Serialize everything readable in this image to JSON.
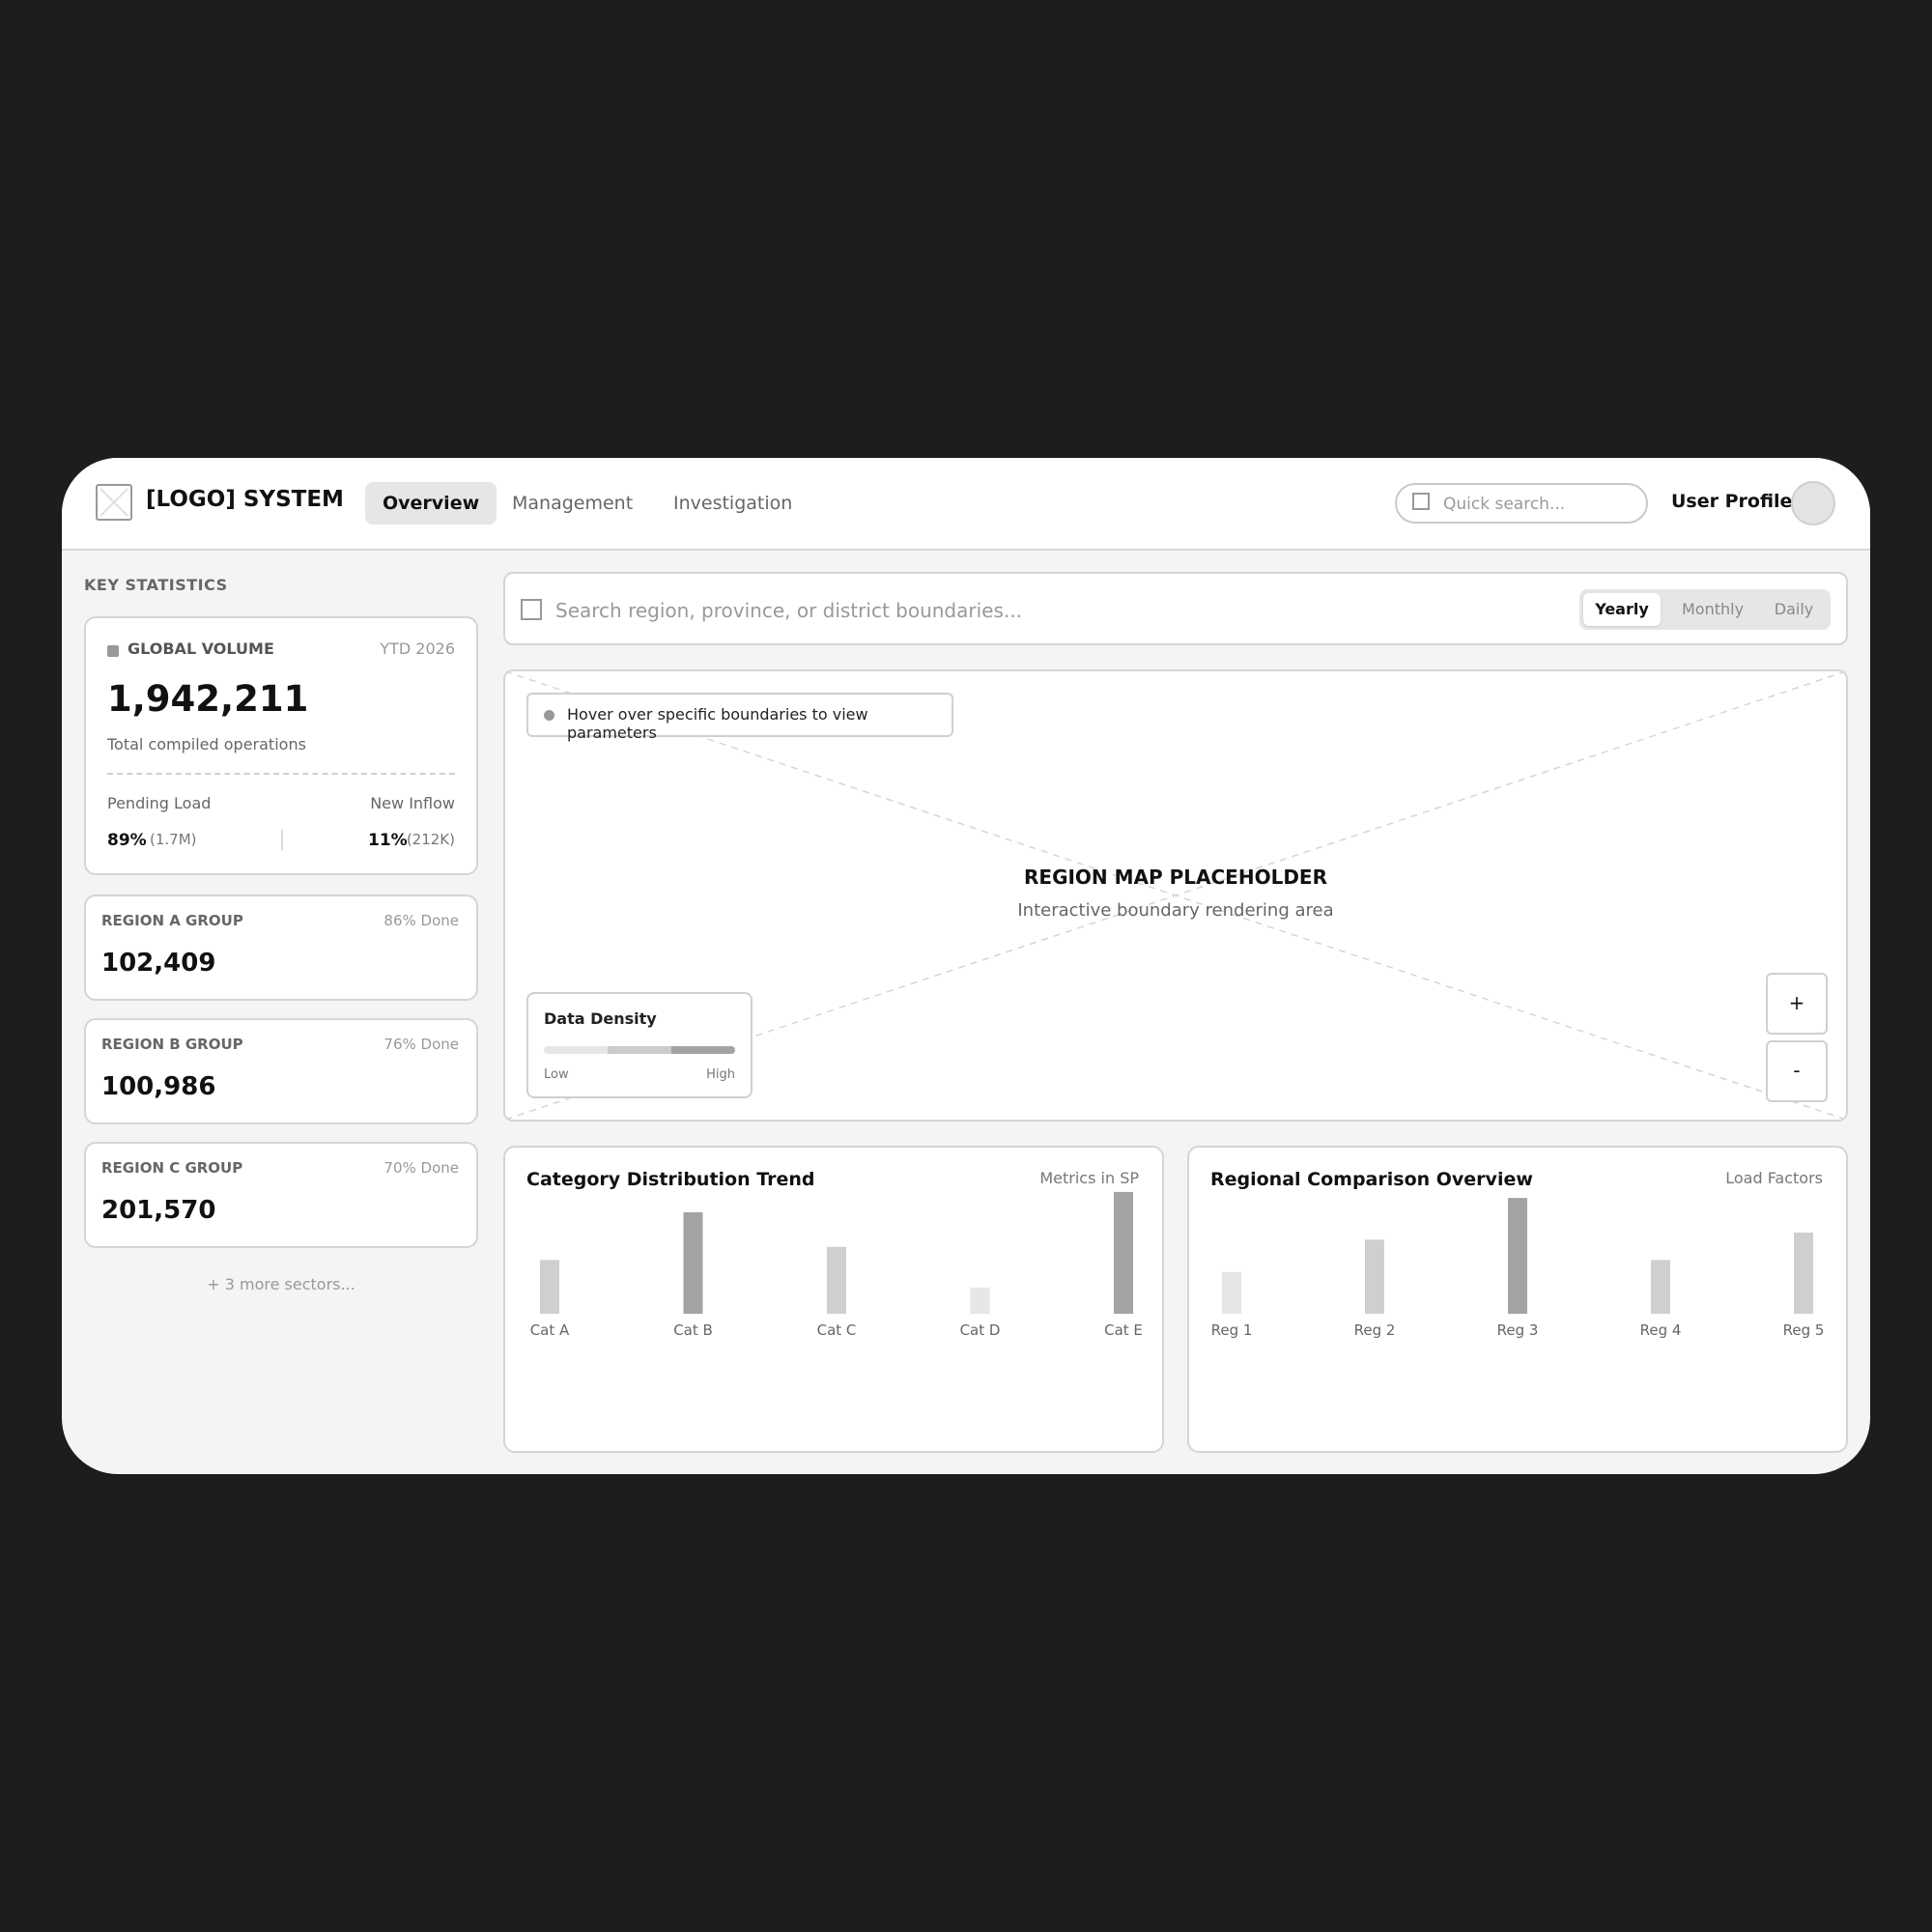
{
  "header": {
    "logo_title": "[LOGO] SYSTEM",
    "nav": [
      {
        "label": "Overview",
        "active": true
      },
      {
        "label": "Management",
        "active": false
      },
      {
        "label": "Investigation",
        "active": false
      }
    ],
    "search_placeholder": "Quick search...",
    "user_label": "User Profile"
  },
  "sidebar": {
    "title": "KEY STATISTICS",
    "global": {
      "label": "GLOBAL VOLUME",
      "period": "YTD 2026",
      "value": "1,942,211",
      "subtitle": "Total compiled operations",
      "pending_label": "Pending Load",
      "inflow_label": "New Inflow",
      "pending_pct": "89%",
      "pending_abs": "(1.7M)",
      "inflow_pct": "11%",
      "inflow_abs": "(212K)"
    },
    "regions": [
      {
        "label": "REGION A GROUP",
        "done": "86% Done",
        "value": "102,409"
      },
      {
        "label": "REGION B GROUP",
        "done": "76% Done",
        "value": "100,986"
      },
      {
        "label": "REGION C GROUP",
        "done": "70% Done",
        "value": "201,570"
      }
    ],
    "more": "+ 3 more sectors..."
  },
  "map": {
    "search_placeholder": "Search region, province, or district boundaries...",
    "periods": [
      {
        "label": "Yearly",
        "active": true
      },
      {
        "label": "Monthly",
        "active": false
      },
      {
        "label": "Daily",
        "active": false
      }
    ],
    "hint": "Hover over specific boundaries to view parameters",
    "title": "REGION MAP PLACEHOLDER",
    "subtitle": "Interactive boundary rendering area",
    "legend": {
      "title": "Data Density",
      "low": "Low",
      "high": "High",
      "colors": [
        "#e6e6e6",
        "#cccccc",
        "#a3a3a3"
      ]
    },
    "zoom_in": "+",
    "zoom_out": "-"
  },
  "colors": {
    "bar_dark": "#a3a3a3",
    "bar_mid": "#cfcfcf",
    "bar_light": "#e6e6e6"
  },
  "chart_data": [
    {
      "type": "bar",
      "title": "Category Distribution Trend",
      "meta": "Metrics in SP",
      "categories": [
        "Cat A",
        "Cat B",
        "Cat C",
        "Cat D",
        "Cat E"
      ],
      "values": [
        45,
        85,
        56,
        22,
        102
      ],
      "shades": [
        "mid",
        "dark",
        "mid",
        "light",
        "dark"
      ],
      "ylim": [
        0,
        110
      ]
    },
    {
      "type": "bar",
      "title": "Regional Comparison Overview",
      "meta": "Load Factors",
      "categories": [
        "Reg 1",
        "Reg 2",
        "Reg 3",
        "Reg 4",
        "Reg 5"
      ],
      "values": [
        35,
        62,
        97,
        45,
        68
      ],
      "shades": [
        "light",
        "mid",
        "dark",
        "mid",
        "mid"
      ],
      "ylim": [
        0,
        110
      ]
    }
  ]
}
